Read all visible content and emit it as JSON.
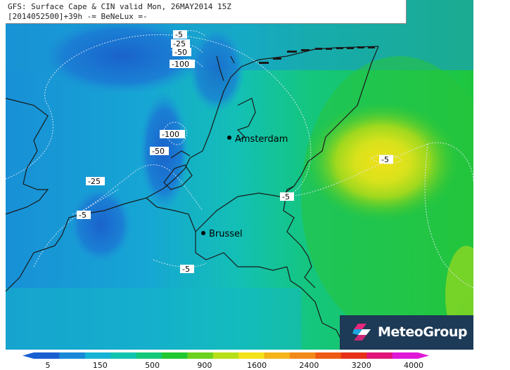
{
  "header": {
    "line1": "GFS: Surface Cape & CIN valid Mon, 26MAY2014 15Z",
    "line2": "[2014052500]+39h -= BeNeLux =-"
  },
  "cities": [
    {
      "name": "Amsterdam"
    },
    {
      "name": "Brussel"
    }
  ],
  "contour_labels": [
    "-5",
    "-25",
    "-50",
    "-100",
    "-100",
    "-50",
    "-25",
    "-5",
    "-5",
    "-5",
    "-5"
  ],
  "legend": {
    "ticks": [
      "5",
      "150",
      "500",
      "900",
      "1600",
      "2400",
      "3200",
      "4000"
    ],
    "colors": [
      "#1a5fd0",
      "#1a8ad8",
      "#16b3d6",
      "#12c4b0",
      "#14c87a",
      "#22c832",
      "#6cd21e",
      "#b8e01a",
      "#f4e21a",
      "#f4b41a",
      "#f28a1a",
      "#ee5a14",
      "#e6301a",
      "#e0147a",
      "#e019d8"
    ]
  },
  "logo": {
    "text": "MeteoGroup"
  }
}
